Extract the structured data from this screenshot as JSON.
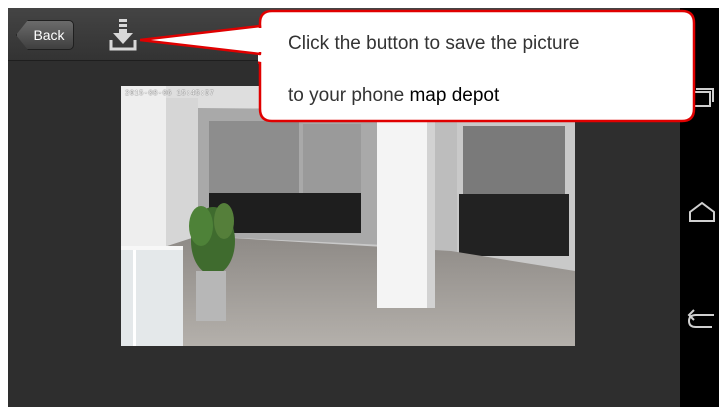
{
  "toolbar": {
    "back_label": "Back",
    "save_icon": "download-icon"
  },
  "video": {
    "timestamp": "2015-08-06 15:45:57"
  },
  "callout": {
    "line1": "Click the button to save the picture",
    "line2_prefix": "to your phone ",
    "line2_highlight": "map depot",
    "border_color": "#e00000"
  },
  "navbar": {
    "icons": [
      "recent-apps-icon",
      "home-icon",
      "back-icon"
    ]
  }
}
